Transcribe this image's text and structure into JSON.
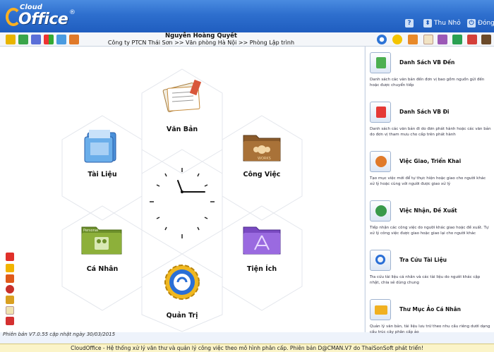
{
  "app": {
    "logo_top": "Cloud",
    "logo_main": "Office",
    "logo_reg": "®"
  },
  "titlebar": {
    "help_label": "?",
    "minimize_label": "Thu Nhỏ",
    "close_label": "Đóng"
  },
  "user": {
    "name": "Nguyễn Hoàng Quyết",
    "path": "Công ty PTCN Thái Sơn >> Văn phòng Hà Nội >> Phòng Lập trình"
  },
  "tiles": {
    "van_ban": "Văn Bản",
    "tai_lieu": "Tài Liệu",
    "cong_viec": "Công Việc",
    "ca_nhan": "Cá Nhân",
    "tien_ich": "Tiện Ích",
    "quan_tri": "Quản Trị",
    "work_label": "WORKS",
    "personal_label": "Personal"
  },
  "sidebar": {
    "items": [
      {
        "title": "Danh Sách VB Đến",
        "desc": "Danh sách các văn bản đến đơn vị bao gồm nguồn gửi đến hoặc được chuyển tiếp"
      },
      {
        "title": "Danh Sách VB Đi",
        "desc": "Danh sách các văn bản đi do đơn phát hành hoặc các văn bản do đơn vị tham mưu cho cấp trên phát hành"
      },
      {
        "title": "Việc Giao, Triển Khai",
        "desc": "Tạo mục việc mới để tự thực hiện hoặc giao cho người khác xử lý hoặc cùng với người được giao xử lý"
      },
      {
        "title": "Việc Nhận, Đề Xuất",
        "desc": "Tiếp nhận các công việc do người khác giao hoặc đề xuất. Tự xử lý công việc được giao hoặc giao lại cho người khác"
      },
      {
        "title": "Tra Cứu Tài Liệu",
        "desc": "Tra cứu tài liệu cá nhân và các tài liệu do người khác cập nhật, chia sẻ dùng chung"
      },
      {
        "title": "Thư Mục Ảo Cá Nhân",
        "desc": "Quản lý văn bản, tài liệu lưu trữ theo nhu cầu riêng dưới dạng cấu trúc cây phân cấp ảo"
      }
    ]
  },
  "footer": {
    "version": "Phiên bản V7.0.55 cập nhật ngày 30/03/2015",
    "status": "CloudOffice - Hệ thống xử lý văn thư và quản lý công việc theo mô hình phân cấp. Phiên bản D@CMAN.V7 do ThaiSonSoft phát triển!"
  },
  "colors": {
    "titlebar": "#2e6fce",
    "statusbar": "#fbf4c8"
  }
}
